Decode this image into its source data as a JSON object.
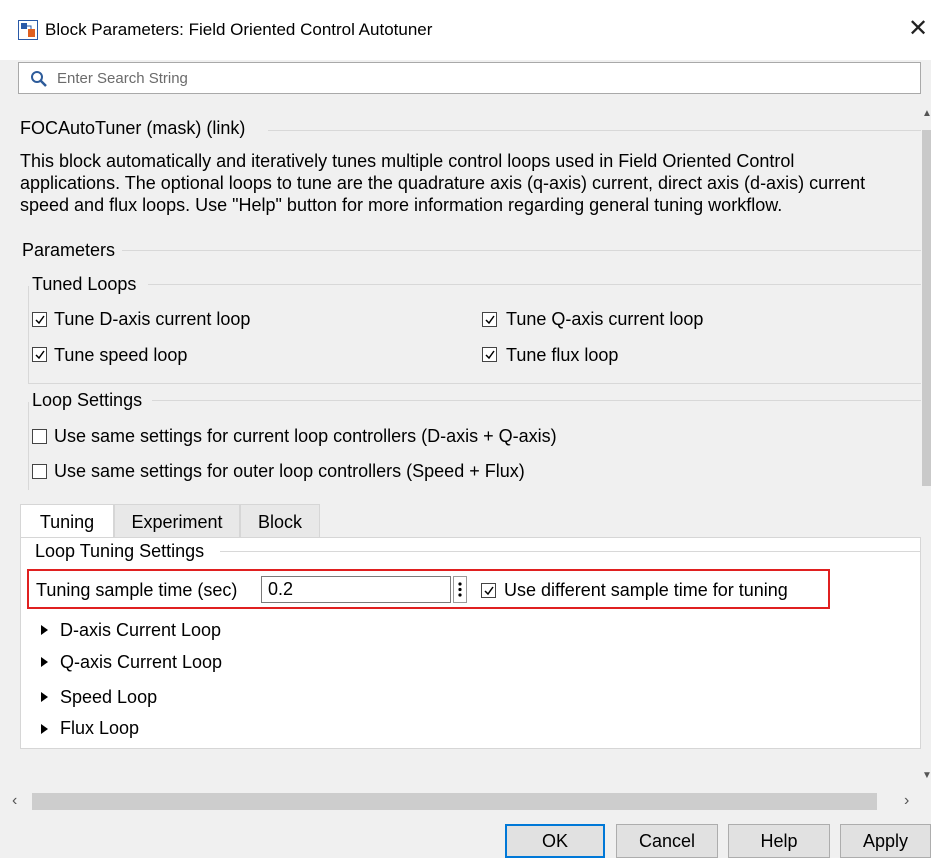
{
  "window": {
    "title": "Block Parameters: Field Oriented Control Autotuner",
    "close_glyph": "✕"
  },
  "search": {
    "placeholder": "Enter Search String",
    "value": ""
  },
  "mask_title": "FOCAutoTuner (mask) (link)",
  "description": [
    "This block automatically and iteratively tunes multiple control loops used in Field Oriented Control",
    "applications.  The optional loops to tune are the quadrature axis (q-axis) current, direct axis (d-axis) current",
    "speed and flux loops. Use \"Help\" button for more information regarding general tuning workflow."
  ],
  "parameters": {
    "label": "Parameters",
    "tuned_loops": {
      "label": "Tuned Loops",
      "items": [
        {
          "label": "Tune D-axis current loop",
          "checked": true
        },
        {
          "label": "Tune Q-axis current loop",
          "checked": true
        },
        {
          "label": "Tune speed loop",
          "checked": true
        },
        {
          "label": "Tune flux loop",
          "checked": true
        }
      ]
    },
    "loop_settings": {
      "label": "Loop Settings",
      "items": [
        {
          "label": "Use same settings for current loop controllers (D-axis + Q-axis)",
          "checked": false
        },
        {
          "label": "Use same settings for outer loop controllers (Speed + Flux)",
          "checked": false
        }
      ]
    }
  },
  "tabs": [
    {
      "label": "Tuning",
      "active": true
    },
    {
      "label": "Experiment",
      "active": false
    },
    {
      "label": "Block",
      "active": false
    }
  ],
  "tuning": {
    "section_label": "Loop Tuning Settings",
    "sample_time_label": "Tuning sample time (sec)",
    "sample_time_value": "0.2",
    "use_different_label": "Use different sample time for tuning",
    "use_different_checked": true,
    "loops": [
      "D-axis Current Loop",
      "Q-axis Current Loop",
      "Speed Loop",
      "Flux Loop"
    ]
  },
  "buttons": {
    "ok": "OK",
    "cancel": "Cancel",
    "help": "Help",
    "apply": "Apply"
  },
  "colors": {
    "highlight_border": "#e02020",
    "default_button_border": "#0078d7"
  }
}
